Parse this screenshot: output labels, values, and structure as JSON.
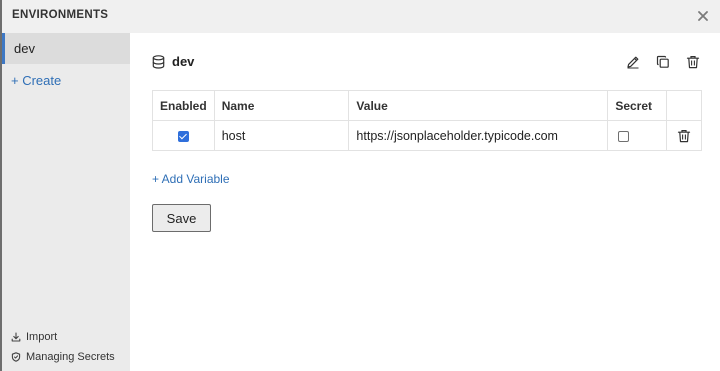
{
  "header": {
    "title": "ENVIRONMENTS",
    "close_icon": "close-icon"
  },
  "sidebar": {
    "environments": [
      {
        "label": "dev",
        "selected": true
      }
    ],
    "create_label": "+ Create",
    "footer": {
      "import_label": "Import",
      "import_icon": "download-icon",
      "secrets_label": "Managing Secrets",
      "secrets_icon": "shield-icon"
    },
    "accent_color": "#3e78c4"
  },
  "main": {
    "environment_name": "dev",
    "environment_icon": "database-icon",
    "actions": [
      "edit-icon",
      "copy-icon",
      "trash-icon"
    ],
    "table": {
      "columns": [
        "Enabled",
        "Name",
        "Value",
        "Secret",
        ""
      ],
      "rows": [
        {
          "enabled": true,
          "name": "host",
          "value": "https://jsonplaceholder.typicode.com",
          "secret": false,
          "delete_icon": "trash-icon"
        }
      ]
    },
    "add_variable_label": "+ Add Variable",
    "save_label": "Save",
    "link_color": "#2f6fb6"
  }
}
